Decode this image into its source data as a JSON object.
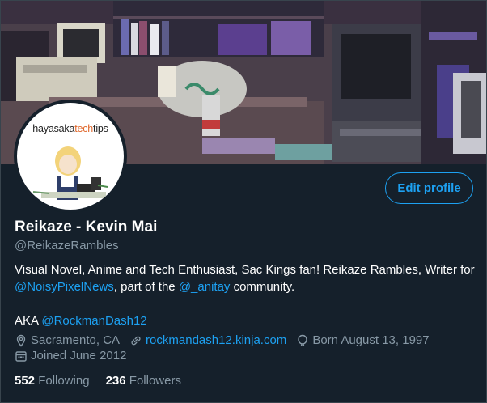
{
  "profile": {
    "avatar_text_prefix": "hayasaka",
    "avatar_text_accent": "tech",
    "avatar_text_suffix": "tips",
    "edit_label": "Edit profile",
    "name": "Reikaze - Kevin Mai",
    "handle": "@ReikazeRambles",
    "bio": {
      "line1": "Visual Novel, Anime and Tech Enthusiast, Sac Kings fan! Reikaze Rambles, Writer for",
      "mention1": "@NoisyPixelNews",
      "mid": ", part of the ",
      "mention2": "@_anitay",
      "end": " community.",
      "aka": "AKA ",
      "mention3": "@RockmanDash12"
    },
    "location": "Sacramento, CA",
    "website": "rockmandash12.kinja.com",
    "birth": "Born August 13, 1997",
    "joined": "Joined June 2012",
    "following_count": "552",
    "following_label": "Following",
    "followers_count": "236",
    "followers_label": "Followers"
  },
  "colors": {
    "background": "#15202b",
    "accent": "#1da1f2",
    "secondary_text": "#8899a6"
  },
  "icons": [
    "location-pin-icon",
    "link-icon",
    "balloon-icon",
    "calendar-icon"
  ]
}
